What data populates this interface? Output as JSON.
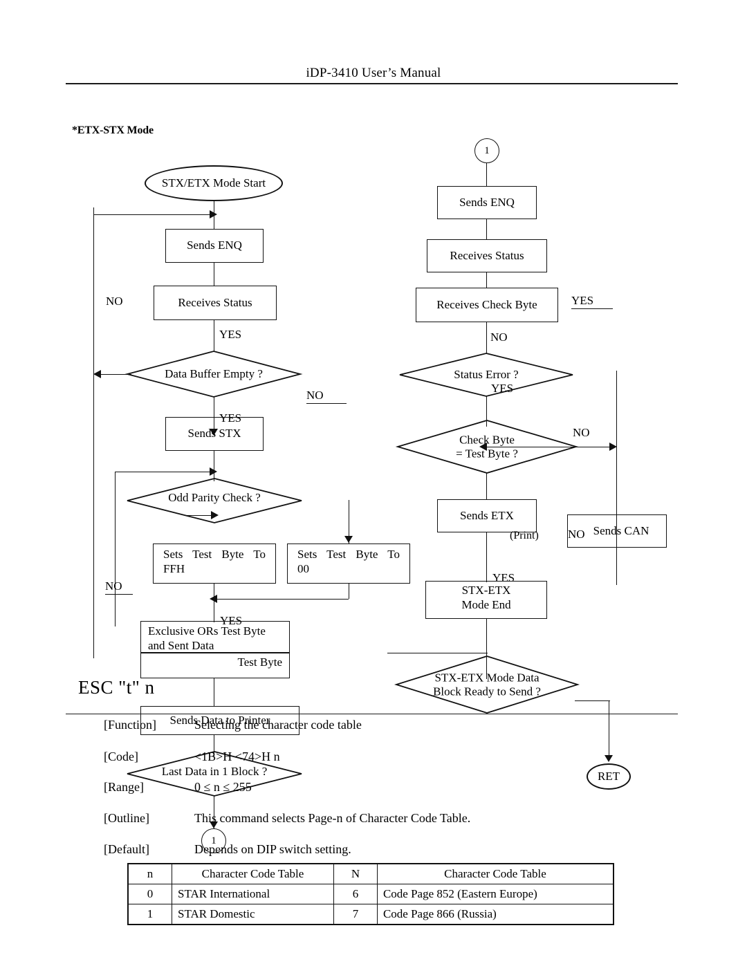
{
  "header": {
    "title": "iDP-3410 User’s Manual"
  },
  "section": {
    "heading": "*ETX-STX Mode"
  },
  "flowchart": {
    "left": {
      "start_terminal": "STX/ETX Mode Start",
      "nodes": [
        {
          "name": "sends-enq",
          "label": "Sends ENQ"
        },
        {
          "name": "receives-status",
          "label": "Receives Status"
        },
        {
          "name": "data-buffer-empty",
          "label": "Data Buffer Empty ?"
        },
        {
          "name": "sends-stx",
          "label": "Sends STX"
        },
        {
          "name": "odd-parity-check",
          "label": "Odd Parity Check ?"
        },
        {
          "name": "sets-test-byte-ffh",
          "label": "Sets Test Byte To",
          "label2": "FFH"
        },
        {
          "name": "sets-test-byte-00",
          "label": "Sets Test Byte To",
          "label2": "00"
        },
        {
          "name": "exclusive-ors",
          "label": "Exclusive ORs Test Byte",
          "label2": "and Sent Data",
          "label3": "Test Byte"
        },
        {
          "name": "sends-data-to-printer",
          "label": "Sends Data to Printer"
        },
        {
          "name": "last-data-in-1-block",
          "label": "Last Data in 1 Block ?"
        }
      ],
      "branch_labels": {
        "no_left": "NO",
        "yes_buffer": "YES",
        "no_buffer": "NO",
        "yes_stx": "YES",
        "no_parity": "NO",
        "yes_parity": "YES"
      },
      "connector": "1"
    },
    "right": {
      "entry_connector": "1",
      "nodes": [
        {
          "name": "sends-enq-2",
          "label": "Sends ENQ"
        },
        {
          "name": "receives-status-2",
          "label": "Receives Status"
        },
        {
          "name": "receives-check-byte",
          "label": "Receives Check Byte"
        },
        {
          "name": "status-error",
          "label": "Status Error ?"
        },
        {
          "name": "check-byte-test-byte",
          "label": "Check Byte",
          "label2": "= Test Byte ?"
        },
        {
          "name": "sends-etx",
          "label": "Sends ETX"
        },
        {
          "name": "sends-can",
          "label": "Sends CAN"
        },
        {
          "name": "stx-etx-mode-end",
          "label": "STX-ETX",
          "label2": "Mode End"
        },
        {
          "name": "block-ready-to-send",
          "label": "STX-ETX Mode Data",
          "label2": "Block Ready to Send ?"
        }
      ],
      "branch_labels": {
        "yes_check_byte": "YES",
        "no_status_error": "NO",
        "yes_status_error": "YES",
        "no_check_byte": "NO",
        "no_can": "NO",
        "yes_end": "YES"
      },
      "print_note": "(Print)",
      "return_terminal": "RET"
    }
  },
  "command": {
    "title": "ESC \"t\" n",
    "rows": [
      {
        "key": "[Function]",
        "value": "Selecting the character code table"
      },
      {
        "key": "[Code]",
        "value": "<1B>H <74>H n"
      },
      {
        "key": "[Range]",
        "value": "0 ≤ n ≤ 255"
      },
      {
        "key": "[Outline]",
        "value": "This command selects Page-n of Character Code Table."
      },
      {
        "key": "[Default]",
        "value": "Depends on DIP switch setting."
      }
    ]
  },
  "code_table": {
    "headers": [
      "n",
      "Character Code Table",
      "N",
      "Character Code Table"
    ],
    "rows": [
      [
        "0",
        "STAR International",
        "6",
        "Code Page 852 (Eastern Europe)"
      ],
      [
        "1",
        "STAR Domestic",
        "7",
        "Code Page 866 (Russia)"
      ]
    ]
  }
}
